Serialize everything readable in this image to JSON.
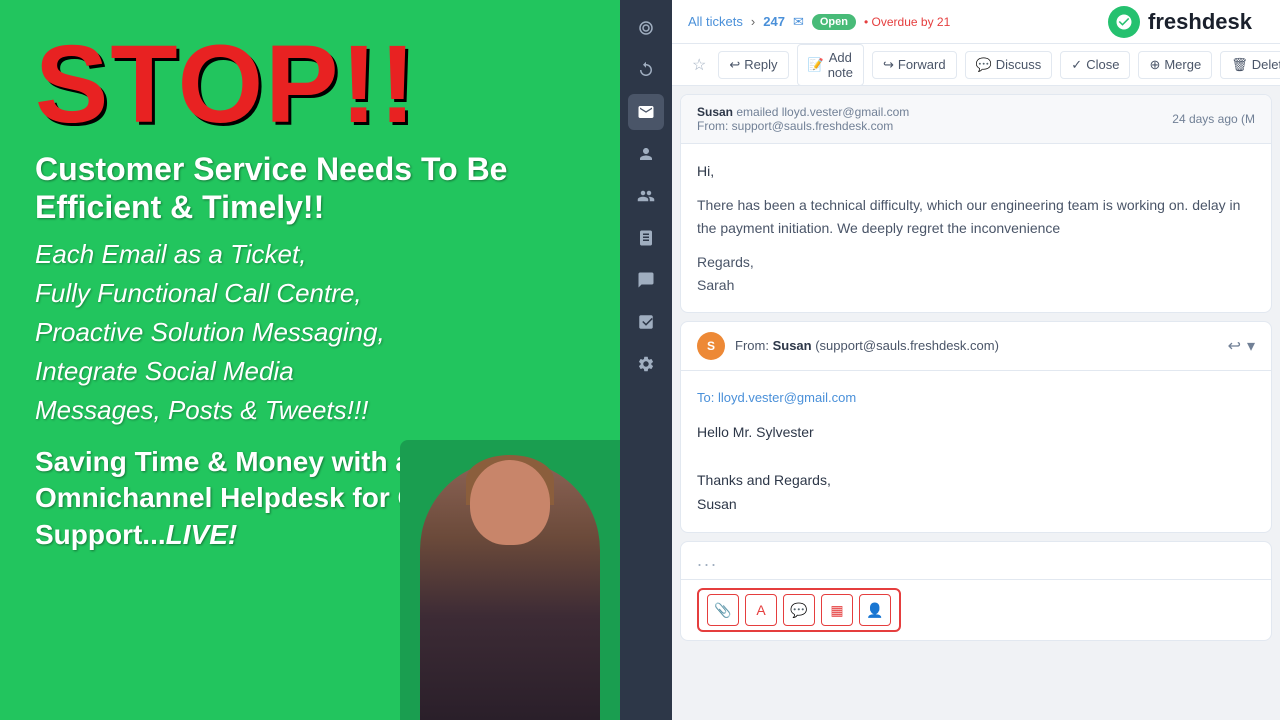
{
  "left_panel": {
    "stop_text": "STOP!!",
    "headline": "Customer Service Needs To Be Efficient & Timely!!",
    "features": "Each Email as a Ticket,\nFully Functional Call Centre,\nProactive Solution Messaging,\nIntegrate Social Media\nMessages, Posts & Tweets!!!",
    "tagline_part1": "Saving Time & Money with an Omnichannel Helpdesk for Customer Support...",
    "tagline_live": "LIVE!"
  },
  "logo": {
    "icon": "🔔",
    "text": "freshdesk"
  },
  "breadcrumb": {
    "all_tickets": "All tickets",
    "ticket_number": "247",
    "status": "Open",
    "overdue": "Overdue by 21"
  },
  "toolbar": {
    "star": "☆",
    "reply": "Reply",
    "add_note": "Add note",
    "forward": "Forward",
    "discuss": "Discuss",
    "close": "Close",
    "merge": "Merge",
    "delete": "Delete"
  },
  "first_email": {
    "sender": "Susan",
    "action": "emailed",
    "to": "lloyd.vester@gmail.com",
    "from_address": "From: support@sauls.freshdesk.com",
    "timestamp": "24 days ago (M",
    "greeting": "Hi,",
    "body": "There has been a technical difficulty, which our engineering team is working on. delay in the payment initiation. We deeply regret the inconvenience",
    "sign_off": "Regards,",
    "signature": "Sarah"
  },
  "second_email": {
    "avatar_letter": "S",
    "from_label": "From:",
    "sender_name": "Susan",
    "sender_email": "(support@sauls.freshdesk.com)",
    "to_label": "To:",
    "to_address": "lloyd.vester@gmail.com",
    "greeting": "Hello Mr. Sylvester",
    "body": "",
    "sign_off": "Thanks and Regards,",
    "signature": "Susan"
  },
  "compose": {
    "dots": "...",
    "toolbar_icons": [
      "📎",
      "A",
      "💬",
      "📋",
      "👤"
    ]
  },
  "sidebar": {
    "icons": [
      "🎵",
      "🔄",
      "📺",
      "👤",
      "🔗",
      "📖",
      "💬",
      "📊",
      "⚙️"
    ]
  }
}
